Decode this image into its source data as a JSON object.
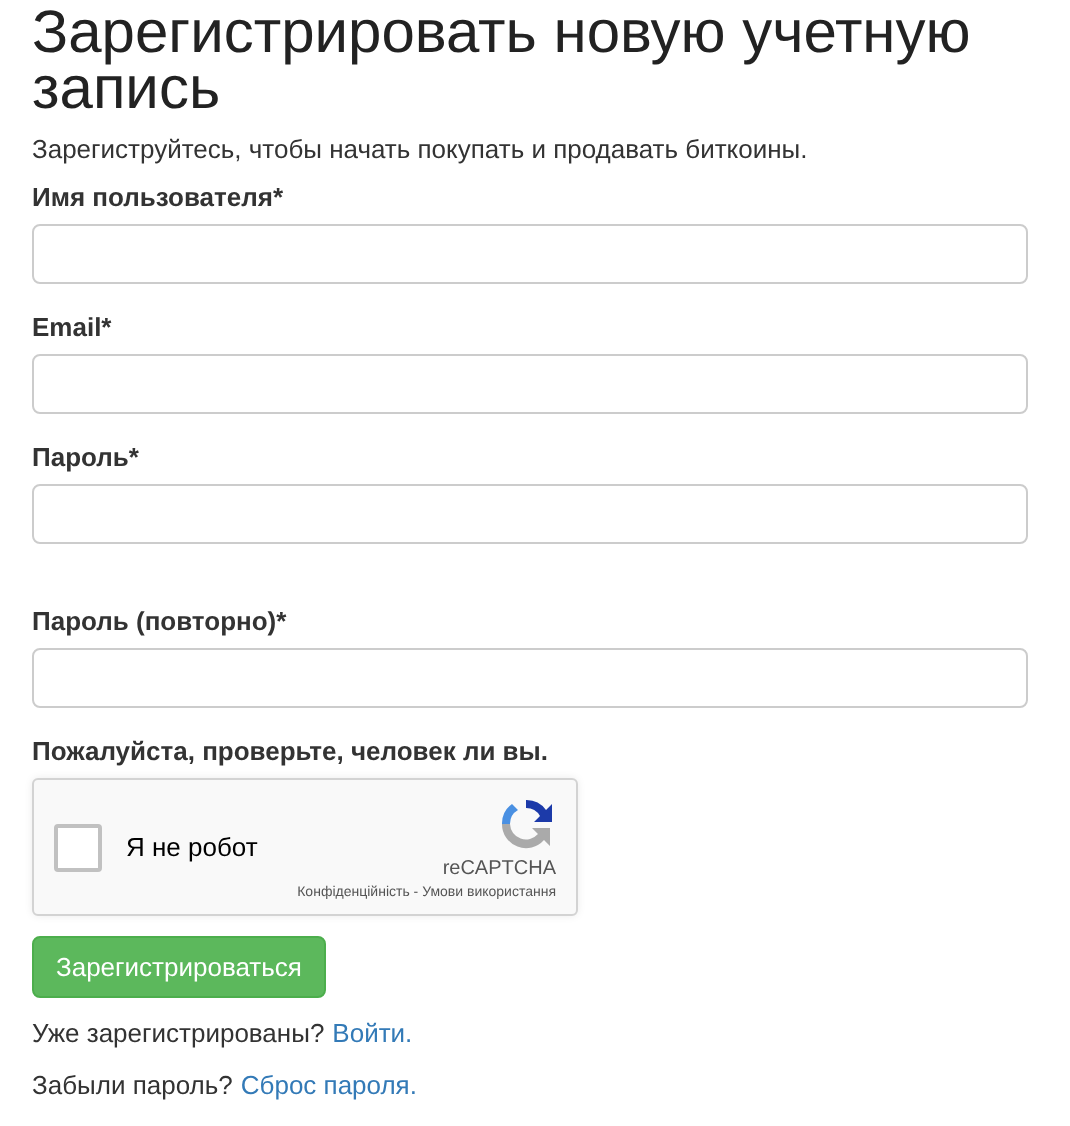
{
  "title": "Зарегистрировать новую учетную запись",
  "subtitle": "Зарегиструйтесь, чтобы начать покупать и продавать биткоины.",
  "fields": [
    {
      "label": "Имя пользователя*"
    },
    {
      "label": "Email*"
    },
    {
      "label": "Пароль*"
    },
    {
      "label": "Пароль (повторно)*"
    }
  ],
  "captcha": {
    "label": "Пожалуйста, проверьте, человек ли вы.",
    "checkbox_text": "Я не робот",
    "checked": false,
    "brand": "reCAPTCHA",
    "privacy": "Конфіденційність",
    "terms": "Умови використання",
    "separator": "-"
  },
  "submit": "Зарегистрироваться",
  "links": [
    {
      "text": "Уже зарегистрированы?",
      "link": "Войти."
    },
    {
      "text": "Забыли пароль?",
      "link": "Сброс пароля."
    }
  ]
}
